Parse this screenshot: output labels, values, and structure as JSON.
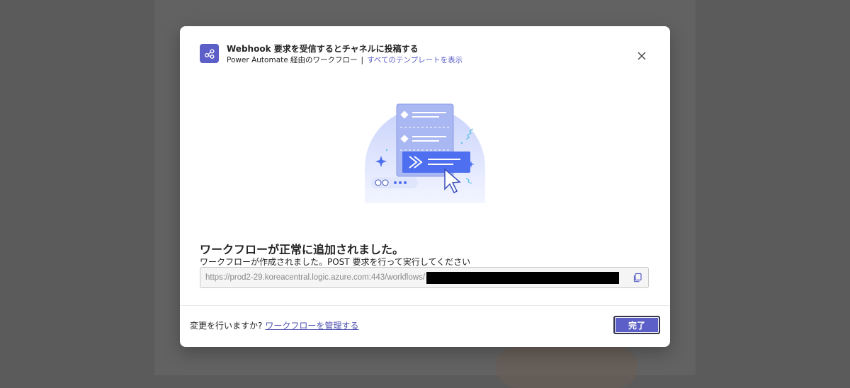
{
  "dialog": {
    "title": "Webhook 要求を受信するとチャネルに投稿する",
    "subtitle_prefix": "Power Automate 経由のワークフロー",
    "subtitle_separator": "|",
    "templates_link": "すべてのテンプレートを表示",
    "app_icon": "workflow-share-icon",
    "close_icon": "close-icon"
  },
  "content": {
    "success_title": "ワークフローが正常に追加されました。",
    "success_message": "ワークフローが作成されました。POST 要求を行って実行してください",
    "url_value": "https://prod2-29.koreacentral.logic.azure.com:443/workflows/",
    "copy_icon": "copy-icon"
  },
  "footer": {
    "question": "変更を行いますか?",
    "manage_link": "ワークフローを管理する",
    "done_label": "完了"
  },
  "colors": {
    "accent": "#5b5fc7",
    "overlay": "#5b5b5b"
  }
}
